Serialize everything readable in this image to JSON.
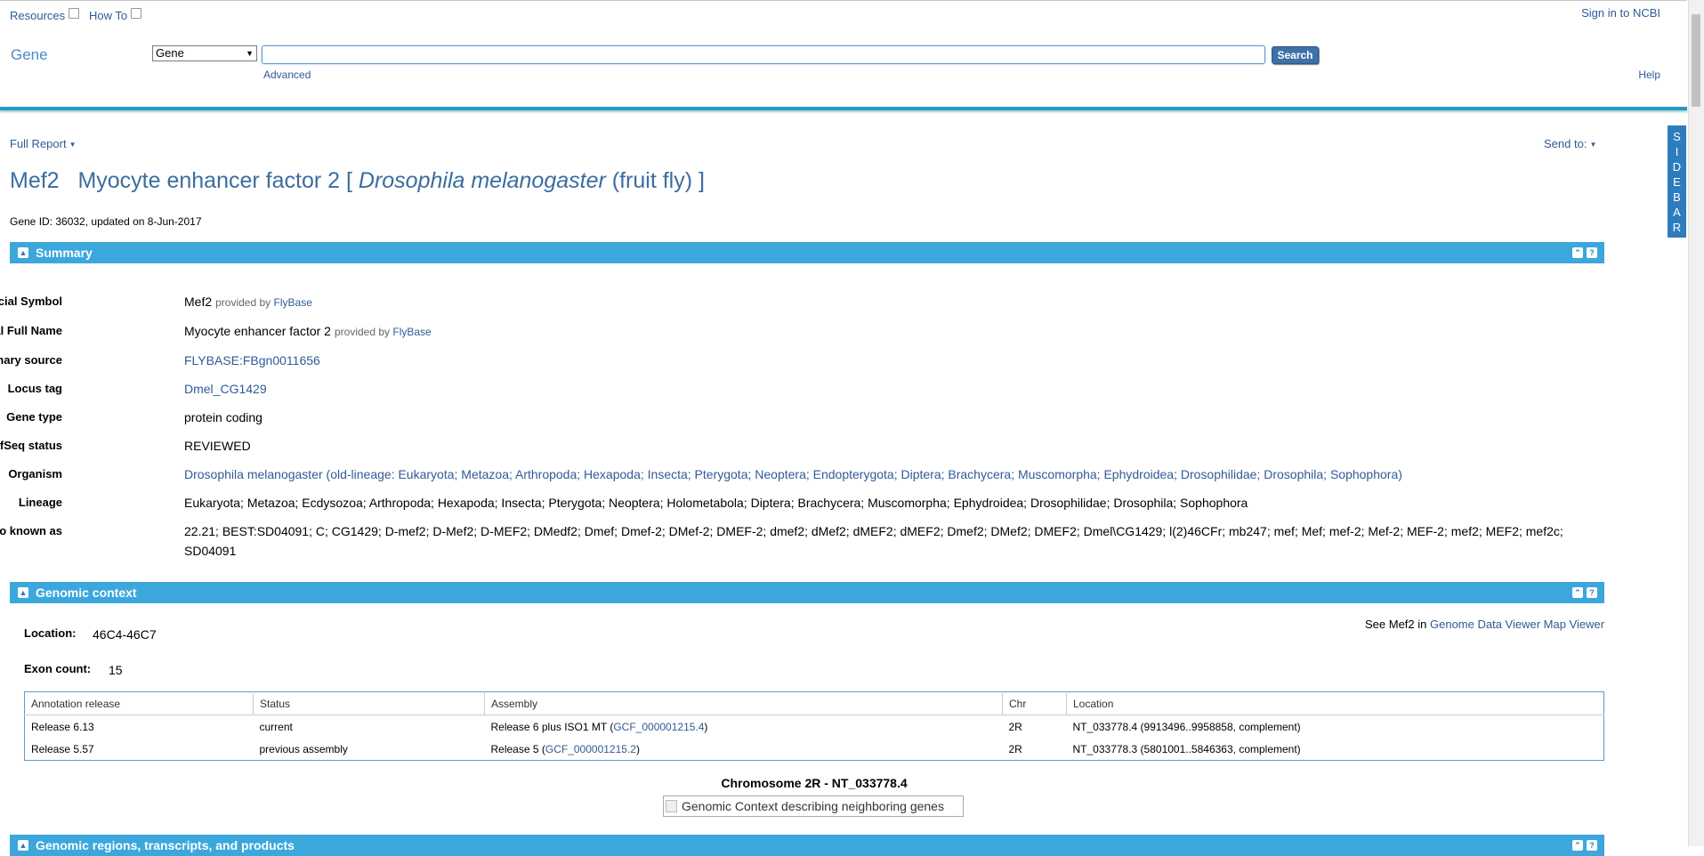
{
  "header": {
    "resources": "Resources",
    "howto": "How To",
    "signin": "Sign in to NCBI",
    "db_title": "Gene",
    "db_select": "Gene",
    "search_value": "",
    "search_button": "Search",
    "advanced": "Advanced",
    "help": "Help"
  },
  "sidebar_tab": [
    "S",
    "I",
    "D",
    "E",
    "B",
    "A",
    "R"
  ],
  "toolbar": {
    "full_report": "Full Report",
    "send_to": "Send to:"
  },
  "title": {
    "symbol": "Mef2",
    "name": "Myocyte enhancer factor 2",
    "open_bracket": "[",
    "species": "Drosophila melanogaster",
    "common": "(fruit fly)",
    "close_bracket": "]"
  },
  "gene_id_line": "Gene ID: 36032, updated on 8-Jun-2017",
  "summary": {
    "header": "Summary",
    "provided_by": "provided by",
    "flybase": "FlyBase",
    "rows": [
      {
        "label": "Official Symbol",
        "value": "Mef2"
      },
      {
        "label": "Official Full Name",
        "value": "Myocyte enhancer factor 2"
      },
      {
        "label": "Primary source",
        "value": "FLYBASE:FBgn0011656"
      },
      {
        "label": "Locus tag",
        "value": "Dmel_CG1429"
      },
      {
        "label": "Gene type",
        "value": "protein coding"
      },
      {
        "label": "RefSeq status",
        "value": "REVIEWED"
      },
      {
        "label": "Organism",
        "value": "Drosophila melanogaster (old-lineage: Eukaryota; Metazoa; Arthropoda; Hexapoda; Insecta; Pterygota; Neoptera; Endopterygota; Diptera; Brachycera; Muscomorpha; Ephydroidea; Drosophilidae; Drosophila; Sophophora)"
      },
      {
        "label": "Lineage",
        "value": "Eukaryota; Metazoa; Ecdysozoa; Arthropoda; Hexapoda; Insecta; Pterygota; Neoptera; Holometabola; Diptera; Brachycera; Muscomorpha; Ephydroidea; Drosophilidae; Drosophila; Sophophora"
      },
      {
        "label": "Also known as",
        "value": "22.21; BEST:SD04091; C; CG1429; D-mef2; D-Mef2; D-MEF2; DMedf2; Dmef; Dmef-2; DMef-2; DMEF-2; dmef2; dMef2; dMEF2; dMEF2; Dmef2; DMef2; DMEF2; Dmel\\CG1429; l(2)46CFr; mb247; mef; Mef; mef-2; Mef-2; MEF-2; mef2; MEF2; mef2c; SD04091"
      }
    ]
  },
  "genomic_context": {
    "header": "Genomic context",
    "location_label": "Location:",
    "location_value": "46C4-46C7",
    "exon_label": "Exon count:",
    "exon_value": "15",
    "see_prefix": "See Mef2 in",
    "gdv_link": "Genome Data Viewer",
    "map_link": "Map Viewer",
    "table": {
      "headers": [
        "Annotation release",
        "Status",
        "Assembly",
        "Chr",
        "Location"
      ],
      "rows": [
        {
          "release": "Release 6.13",
          "status": "current",
          "assembly_text": "Release 6 plus ISO1 MT (",
          "assembly_link": "GCF_000001215.4",
          "assembly_close": ")",
          "chr": "2R",
          "location": "NT_033778.4 (9913496..9958858, complement)"
        },
        {
          "release": "Release 5.57",
          "status": "previous assembly",
          "assembly_text": "Release 5 (",
          "assembly_link": "GCF_000001215.2",
          "assembly_close": ")",
          "chr": "2R",
          "location": "NT_033778.3 (5801001..5846363, complement)"
        }
      ]
    },
    "chrom_caption": "Chromosome 2R - NT_033778.4",
    "image_alt": "Genomic Context describing neighboring genes"
  },
  "next_section": {
    "header": "Genomic regions, transcripts, and products"
  }
}
